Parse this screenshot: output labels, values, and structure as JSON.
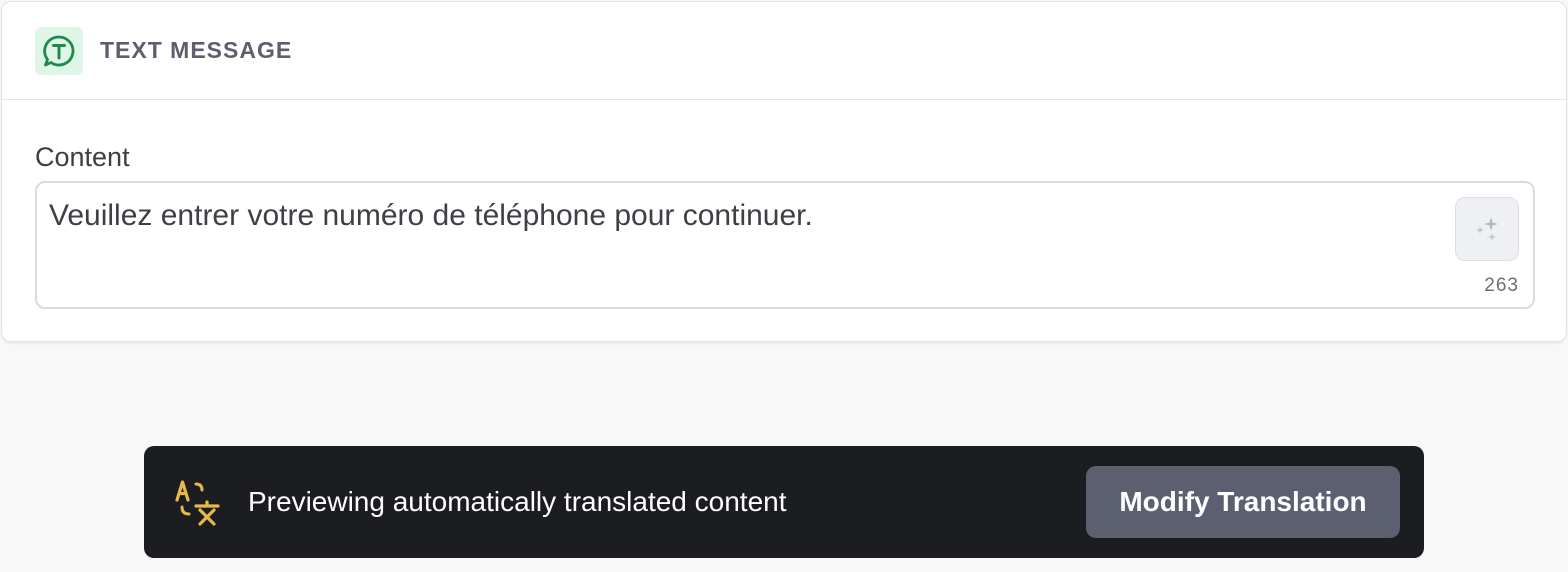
{
  "card": {
    "channel_icon": "chat-bubble-t-icon",
    "title": "TEXT MESSAGE",
    "content_label": "Content",
    "content_value": "Veuillez entrer votre numéro de téléphone pour continuer.",
    "ai_button_icon": "sparkles-icon",
    "char_count": "263"
  },
  "banner": {
    "icon": "translate-icon",
    "text": "Previewing automatically translated content",
    "button_label": "Modify Translation"
  },
  "colors": {
    "accent_green": "#1e8a4c",
    "banner_bg": "#1c1d21",
    "button_bg": "#5b5f70",
    "translate_icon": "#e8b84a"
  }
}
